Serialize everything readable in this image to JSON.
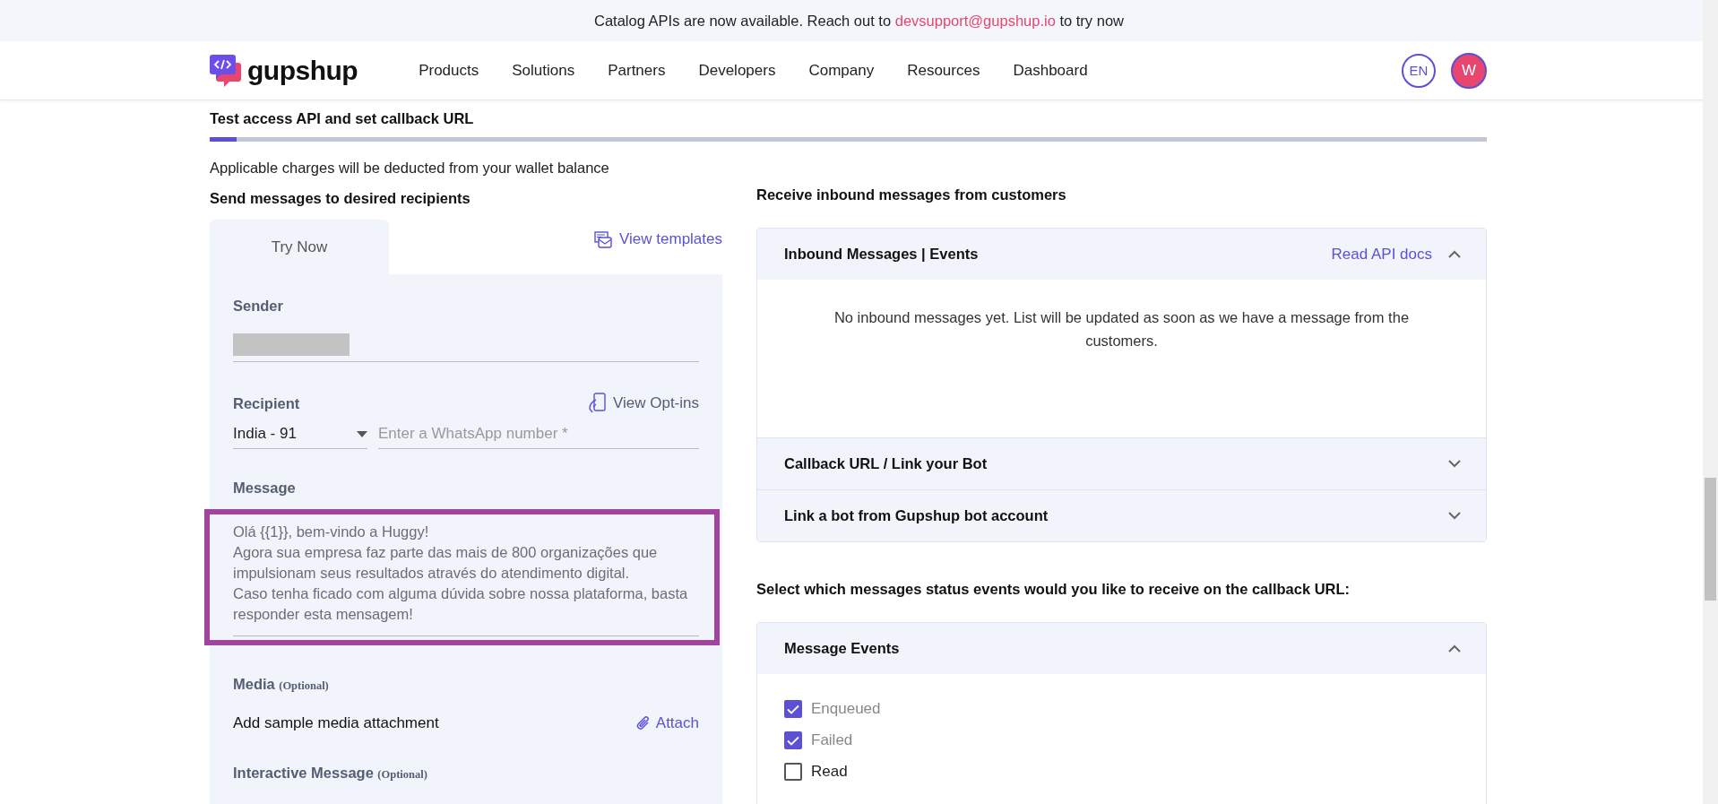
{
  "banner": {
    "text_before": "Catalog APIs are now available. Reach out to ",
    "link": "devsupport@gupshup.io",
    "text_after": " to try now"
  },
  "nav": {
    "logo": "gupshup",
    "items": [
      "Products",
      "Solutions",
      "Partners",
      "Developers",
      "Company",
      "Resources",
      "Dashboard"
    ],
    "language": "EN",
    "avatar": "W"
  },
  "section": {
    "title": "Test access API and set callback URL",
    "level": 0.021
  },
  "left": {
    "note": "Applicable charges will be deducted from your wallet balance",
    "heading": "Send messages to desired recipients",
    "tabs": [
      {
        "label": "Try Now",
        "selected": true
      }
    ],
    "view_templates": "View templates",
    "form": {
      "sender_label": "Sender",
      "recipient_label": "Recipient",
      "view_opt_ins": "View Opt-ins",
      "country": "India - 91",
      "number_placeholder": "Enter a WhatsApp number *",
      "message_label": "Message",
      "message": "Olá {{1}}, bem-vindo a Huggy!\nAgora sua empresa faz parte das mais de 800 organizações que impulsionam seus resultados através do atendimento digital.\nCaso tenha ficado com alguma dúvida sobre nossa plataforma, basta responder esta mensagem!",
      "media_label": "Media",
      "media_optional": "(Optional)",
      "media_hint": "Add sample media attachment",
      "attach": "Attach",
      "interactive_label": "Interactive Message",
      "interactive_optional": "(Optional)"
    }
  },
  "right": {
    "heading": "Receive inbound messages from customers",
    "accordions": [
      {
        "title": "Inbound Messages | Events",
        "link": "Read API docs",
        "expanded": true,
        "body": "No inbound messages yet. List will be updated as soon as we have a message from the customers."
      },
      {
        "title": "Callback URL / Link your Bot",
        "expanded": false
      },
      {
        "title": "Link a bot from Gupshup bot account",
        "expanded": false
      }
    ],
    "status_heading": "Select which messages status events would you like to receive on the callback URL:",
    "message_events": {
      "title": "Message Events",
      "expanded": true,
      "events": [
        {
          "label": "Enqueued",
          "checked": true,
          "disabled": true
        },
        {
          "label": "Failed",
          "checked": true,
          "disabled": true
        },
        {
          "label": "Read",
          "checked": false,
          "disabled": false
        }
      ]
    }
  }
}
